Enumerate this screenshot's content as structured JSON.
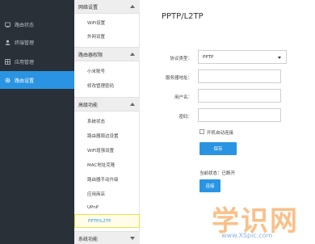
{
  "leftnav": {
    "items": [
      {
        "label": "路由状态",
        "icon": "router-status-icon"
      },
      {
        "label": "终端管理",
        "icon": "user-icon"
      },
      {
        "label": "应用管理",
        "icon": "apps-icon"
      },
      {
        "label": "路由设置",
        "icon": "gear-icon",
        "active": true
      }
    ]
  },
  "submenu": {
    "groups": [
      {
        "title": "网络设置",
        "items": [
          "WiFi设置",
          "外网设置"
        ]
      },
      {
        "title": "路由器权限",
        "items": [
          "小米账号",
          "修改管理密码"
        ]
      },
      {
        "title": "高级功能",
        "items": [
          "系统状态",
          "路由器周边设置",
          "WiFi增强设置",
          "MAC地址克隆",
          "路由器手动升级",
          "应用商店",
          "UPnP",
          "PPTP/L2TP"
        ]
      },
      {
        "title": "系统功能",
        "items": []
      }
    ],
    "active_item": "PPTP/L2TP"
  },
  "main": {
    "title": "PPTP/L2TP",
    "protocol_label": "协议类型：",
    "protocol_value": "PPTP",
    "server_label": "服务器地址：",
    "username_label": "用户名：",
    "password_label": "密码：",
    "autoconnect_label": "开机自动连接",
    "save_button": "保存",
    "status_text": "当前状态：已断开",
    "connect_button": "连接"
  },
  "watermark": {
    "big": "学识网",
    "url": "www.XSpic.com"
  },
  "colors": {
    "accent": "#2a94e2",
    "nav_bg": "#2a3038",
    "highlight_border": "#e8e24a"
  }
}
